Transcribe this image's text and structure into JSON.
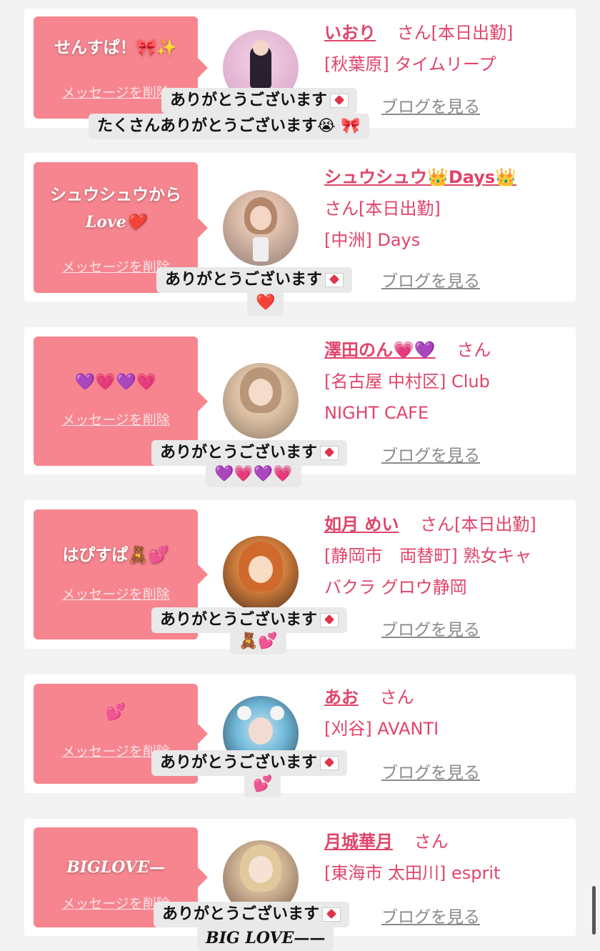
{
  "common": {
    "delete_label": "メッセージを削除",
    "blog_label": "ブログを見る",
    "san": "さん"
  },
  "cards": [
    {
      "bubble_message": "せんすぱ！🎀✨",
      "name": "いおり",
      "work_status": "[本日出勤]",
      "location_shop": "[秋葉原] タイムリープ",
      "reply_line1": "ありがとうございます",
      "reply_line2": "たくさんありがとうございます😭 🎀"
    },
    {
      "bubble_message": "シュウシュウから",
      "bubble_message_2": "Love❤️",
      "name": "シュウシュウ👑Days👑",
      "work_status": "[本日出勤]",
      "location_shop": "[中洲] Days",
      "reply_line1": "ありがとうございます",
      "reply_line2": "❤️"
    },
    {
      "bubble_message": "💜💗💜💗",
      "name": "澤田のん💗💜",
      "work_status": "",
      "location_shop": "[名古屋 中村区] Club",
      "location_shop_2": "NIGHT CAFE",
      "reply_line1": "ありがとうございます",
      "reply_line2": "💜💗💜💗"
    },
    {
      "bubble_message": "はぴすぱ🧸💕",
      "name": "如月 めい",
      "work_status": "[本日出勤]",
      "location_shop": "[静岡市　両替町] 熟女キャ",
      "location_shop_2": "バクラ グロウ静岡",
      "reply_line1": "ありがとうございます",
      "reply_line2": "🧸💕"
    },
    {
      "bubble_message": "💕",
      "name": "あお",
      "work_status": "",
      "location_shop": "[刈谷] AVANTI",
      "reply_line1": "ありがとうございます",
      "reply_line2": "💕"
    },
    {
      "bubble_message": "BIGLOVE—",
      "name": "月城華月",
      "work_status": "",
      "location_shop": "[東海市 太田川] esprit",
      "reply_line1": "ありがとうございます",
      "reply_line2": "BIG LOVE——"
    }
  ]
}
